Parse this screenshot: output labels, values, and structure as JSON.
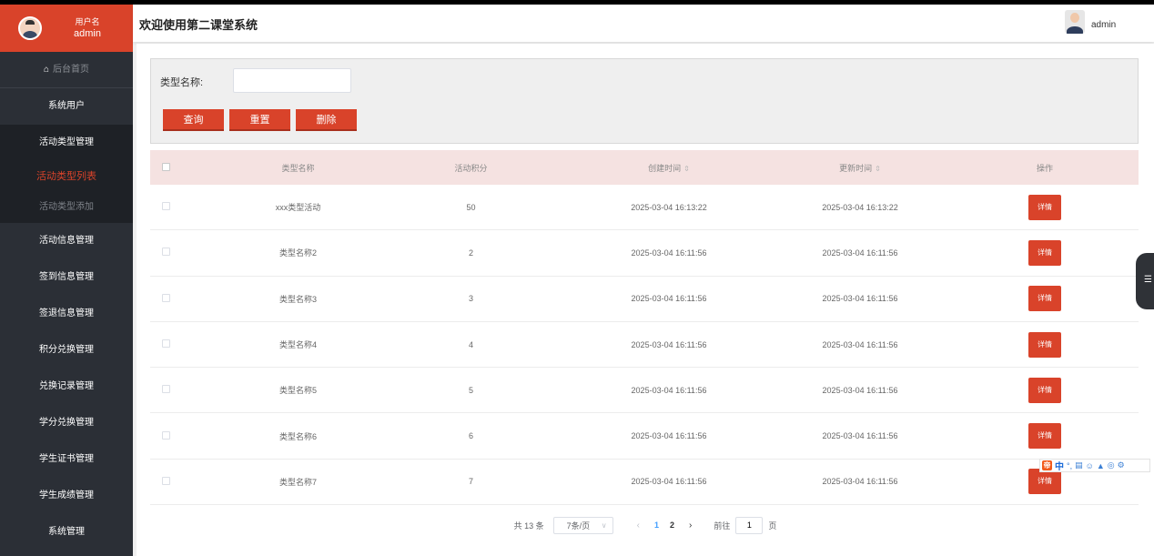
{
  "sidebar": {
    "user_label": "用户名",
    "username": "admin",
    "home": "后台首页",
    "items": [
      {
        "label": "系统用户"
      },
      {
        "label": "活动类型管理"
      },
      {
        "label": "活动类型列表"
      },
      {
        "label": "活动类型添加"
      },
      {
        "label": "活动信息管理"
      },
      {
        "label": "签到信息管理"
      },
      {
        "label": "签退信息管理"
      },
      {
        "label": "积分兑换管理"
      },
      {
        "label": "兑换记录管理"
      },
      {
        "label": "学分兑换管理"
      },
      {
        "label": "学生证书管理"
      },
      {
        "label": "学生成绩管理"
      },
      {
        "label": "系统管理"
      }
    ]
  },
  "header": {
    "title": "欢迎使用第二课堂系统",
    "user": "admin"
  },
  "search": {
    "label": "类型名称:",
    "value": "",
    "query_label": "查询",
    "reset_label": "重置",
    "delete_label": "删除"
  },
  "table": {
    "columns": {
      "name": "类型名称",
      "score": "活动积分",
      "created": "创建时间",
      "updated": "更新时间",
      "op": "操作"
    },
    "detail_label": "详情",
    "rows": [
      {
        "name": "xxx类型活动",
        "score": "50",
        "created": "2025-03-04 16:13:22",
        "updated": "2025-03-04 16:13:22"
      },
      {
        "name": "类型名称2",
        "score": "2",
        "created": "2025-03-04 16:11:56",
        "updated": "2025-03-04 16:11:56"
      },
      {
        "name": "类型名称3",
        "score": "3",
        "created": "2025-03-04 16:11:56",
        "updated": "2025-03-04 16:11:56"
      },
      {
        "name": "类型名称4",
        "score": "4",
        "created": "2025-03-04 16:11:56",
        "updated": "2025-03-04 16:11:56"
      },
      {
        "name": "类型名称5",
        "score": "5",
        "created": "2025-03-04 16:11:56",
        "updated": "2025-03-04 16:11:56"
      },
      {
        "name": "类型名称6",
        "score": "6",
        "created": "2025-03-04 16:11:56",
        "updated": "2025-03-04 16:11:56"
      },
      {
        "name": "类型名称7",
        "score": "7",
        "created": "2025-03-04 16:11:56",
        "updated": "2025-03-04 16:11:56"
      }
    ]
  },
  "pagination": {
    "total": "共 13 条",
    "page_size": "7条/页",
    "pages": [
      "1",
      "2"
    ],
    "current": "1",
    "goto_label": "前往",
    "goto_value": "1",
    "page_unit": "页"
  },
  "ime": {
    "mode": "中"
  },
  "colors": {
    "accent": "#d9432a",
    "sidebar": "#2b2f36",
    "table_header": "#f5e2e1",
    "page_active": "#409eff"
  }
}
